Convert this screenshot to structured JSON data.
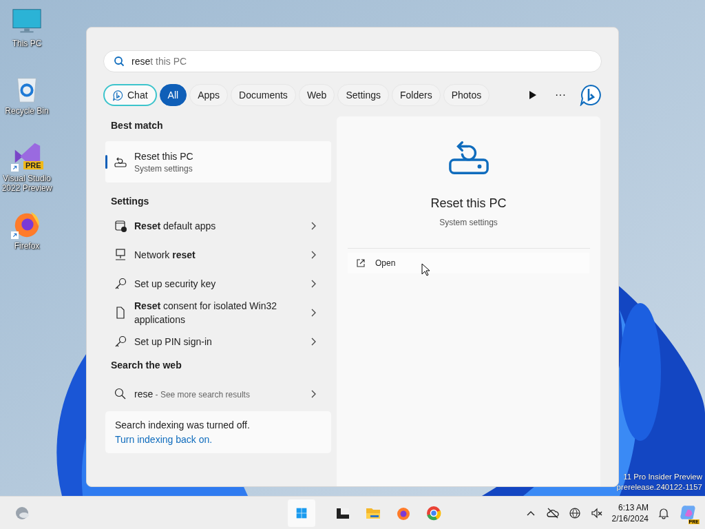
{
  "desktop_icons": [
    {
      "kind": "monitor",
      "label": "This PC",
      "shortcut": false
    },
    {
      "kind": "recycle",
      "label": "Recycle Bin",
      "shortcut": false
    },
    {
      "kind": "studio",
      "label": "Visual Studio 2022 Preview",
      "badge": "PRE",
      "shortcut": true
    },
    {
      "kind": "firefox",
      "label": "Firefox",
      "shortcut": true
    }
  ],
  "search": {
    "typed": "rese",
    "completion": "t this PC"
  },
  "filters": [
    {
      "label": "Chat",
      "kind": "chat",
      "selected": false
    },
    {
      "label": "All",
      "kind": "plain",
      "selected": true
    },
    {
      "label": "Apps",
      "kind": "plain",
      "selected": false
    },
    {
      "label": "Documents",
      "kind": "plain",
      "selected": false
    },
    {
      "label": "Web",
      "kind": "plain",
      "selected": false
    },
    {
      "label": "Settings",
      "kind": "plain",
      "selected": false
    },
    {
      "label": "Folders",
      "kind": "plain",
      "selected": false
    },
    {
      "label": "Photos",
      "kind": "plain",
      "selected": false
    }
  ],
  "more_button": "···",
  "best_match": {
    "heading": "Best match",
    "title": "Reset this PC",
    "subtitle": "System settings",
    "selected": true
  },
  "settings": {
    "heading": "Settings",
    "items": [
      {
        "kind": "apps",
        "text": "**Reset** default apps"
      },
      {
        "kind": "network",
        "text": "Network **reset**"
      },
      {
        "kind": "key",
        "text": "Set up security key"
      },
      {
        "kind": "file",
        "text": "**Reset** consent for isolated Win32 applications"
      },
      {
        "kind": "key",
        "text": "Set up PIN sign-in"
      }
    ]
  },
  "web": {
    "heading": "Search the web",
    "query": "rese",
    "hint": " - See more search results"
  },
  "indexing": {
    "message": "Search indexing was turned off.",
    "link": "Turn indexing back on."
  },
  "preview": {
    "title": "Reset this PC",
    "subtitle": "System settings",
    "actions": [
      "Open"
    ]
  },
  "watermark": [
    "11 Pro Insider Preview",
    "prerelease.240122-1157"
  ],
  "taskbar": {
    "apps": [
      {
        "kind": "start"
      },
      {
        "kind": "taskview"
      },
      {
        "kind": "explorer"
      },
      {
        "kind": "firefox"
      },
      {
        "kind": "chrome"
      }
    ],
    "tray": [
      {
        "kind": "chevron"
      },
      {
        "kind": "cloud-off"
      },
      {
        "kind": "globe"
      },
      {
        "kind": "mute"
      }
    ],
    "time": "6:13 AM",
    "date": "2/16/2024",
    "copilot_badge": "PRE"
  }
}
